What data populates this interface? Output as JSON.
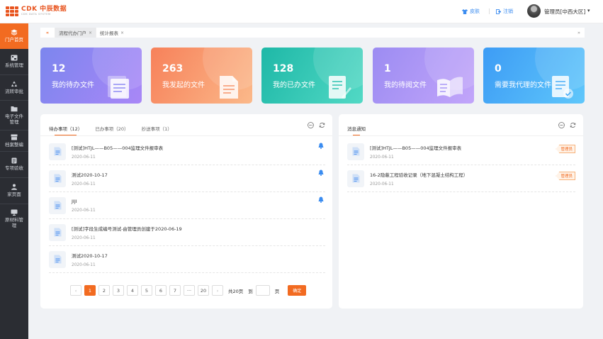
{
  "header": {
    "logo_main": "CDK 中辰数据",
    "logo_sub": "CDK DATA SYSTEM",
    "skin_label": "皮肤",
    "logout_label": "注销",
    "user_label": "管理员[中西大区]",
    "caret": "▾"
  },
  "sidebar": {
    "items": [
      {
        "label": "门户首页",
        "icon": "layers-icon"
      },
      {
        "label": "系统管理",
        "icon": "settings-icon"
      },
      {
        "label": "流转审批",
        "icon": "recycle-icon"
      },
      {
        "label": "电子文件管理",
        "icon": "folder-icon"
      },
      {
        "label": "档案整编",
        "icon": "archive-icon"
      },
      {
        "label": "专项验收",
        "icon": "clipboard-icon"
      },
      {
        "label": "家页面",
        "icon": "user-icon"
      },
      {
        "label": "原材料管理",
        "icon": "material-icon"
      }
    ]
  },
  "tabs": {
    "back": "«",
    "next": "»",
    "items": [
      {
        "label": "流程代办门户",
        "close": "×"
      },
      {
        "label": "统计报表",
        "close": "×"
      }
    ]
  },
  "stats": [
    {
      "num": "12",
      "label": "我的待办文件"
    },
    {
      "num": "263",
      "label": "我发起的文件"
    },
    {
      "num": "128",
      "label": "我的已办文件"
    },
    {
      "num": "1",
      "label": "我的待阅文件"
    },
    {
      "num": "0",
      "label": "需要我代理的文件"
    }
  ],
  "todo": {
    "tabs": [
      "待办事项（12）",
      "已办事项（20）",
      "抄送事项（1）"
    ],
    "rows": [
      {
        "title": "[测试]HTJL——B05——004监理文件报审表",
        "date": "2020-06-11",
        "bell": true
      },
      {
        "title": "测试2020-10-17",
        "date": "2020-06-11",
        "bell": true
      },
      {
        "title": "JIJI",
        "date": "2020-06-11",
        "bell": true
      },
      {
        "title": "[测试]字段生成编号测试-由管理员创建于2020-06-19",
        "date": "2020-06-11",
        "bell": false
      },
      {
        "title": "测试2020-10-17",
        "date": "2020-06-11",
        "bell": false
      }
    ],
    "pager": {
      "prev": "‹",
      "pages": [
        "1",
        "2",
        "3",
        "4",
        "5",
        "6",
        "7",
        "···",
        "20"
      ],
      "next": "›",
      "total": "共20页",
      "goto": "到",
      "unit": "页",
      "confirm": "确定"
    }
  },
  "messages": {
    "title": "消息通知",
    "rows": [
      {
        "title": "[测试]HTJL——B05——004监理文件报审表",
        "date": "2020-06-11",
        "badge": "管理员"
      },
      {
        "title": "16-2隐蔽工程验收记录（地下混凝土结构工程）",
        "date": "2020-06-11",
        "badge": "管理员"
      }
    ]
  },
  "colors": {
    "accent": "#f26b21",
    "link": "#3b8cf0",
    "sidebar": "#2b2d33"
  }
}
